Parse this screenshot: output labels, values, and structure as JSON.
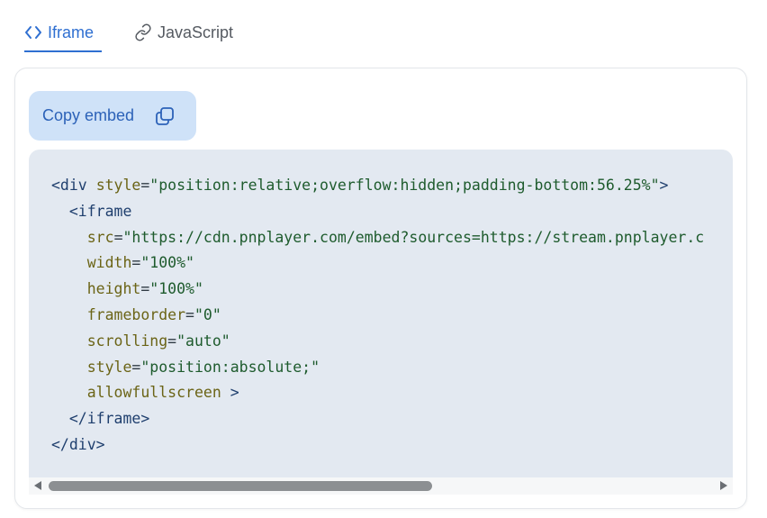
{
  "tabs": [
    {
      "label": "Iframe",
      "icon": "code-brackets-icon",
      "active": true
    },
    {
      "label": "JavaScript",
      "icon": "link-icon",
      "active": false
    }
  ],
  "copy_button": {
    "label": "Copy embed",
    "icon": "copy-icon"
  },
  "code_lines": [
    "<div style=\"position:relative;overflow:hidden;padding-bottom:56.25%\">",
    "  <iframe",
    "    src=\"https://cdn.pnplayer.com/embed?sources=https://stream.pnplayer.c",
    "    width=\"100%\"",
    "    height=\"100%\"",
    "    frameborder=\"0\"",
    "    scrolling=\"auto\"",
    "    style=\"position:absolute;\"",
    "    allowfullscreen >",
    "  </iframe>",
    "</div>"
  ],
  "colors": {
    "accent": "#2f6fd1",
    "button_bg": "#cfe2f8",
    "code_bg": "#e3e9f1"
  }
}
